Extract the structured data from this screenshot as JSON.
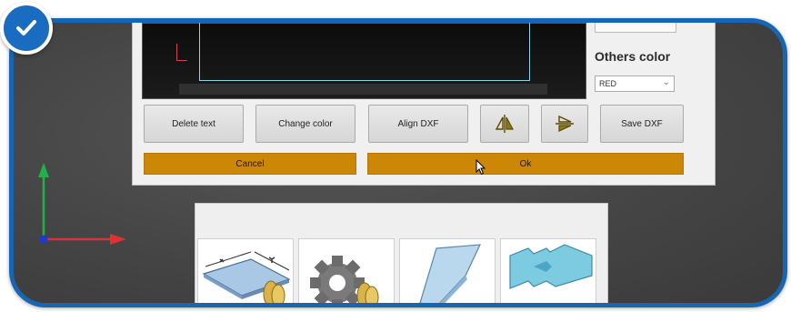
{
  "dialog": {
    "others_color_label": "Others color",
    "others_color_value": "RED",
    "buttons": {
      "delete_text": "Delete text",
      "change_color": "Change color",
      "align_dxf": "Align DXF",
      "save_dxf": "Save DXF"
    },
    "cancel_label": "Cancel",
    "ok_label": "Ok"
  },
  "icons": {
    "badge": "checkmark-icon",
    "mirror_vertical": "mirror-vertical-icon",
    "mirror_horizontal": "mirror-horizontal-icon",
    "gizmo": "xyz-axes-icon"
  },
  "colors": {
    "frame_border": "#1766b3",
    "bar_orange": "#cc8706",
    "canvas_line": "#8bd6e6",
    "axis_x": "#e03030",
    "axis_y": "#22b04a",
    "axis_z": "#1a3ad0"
  }
}
